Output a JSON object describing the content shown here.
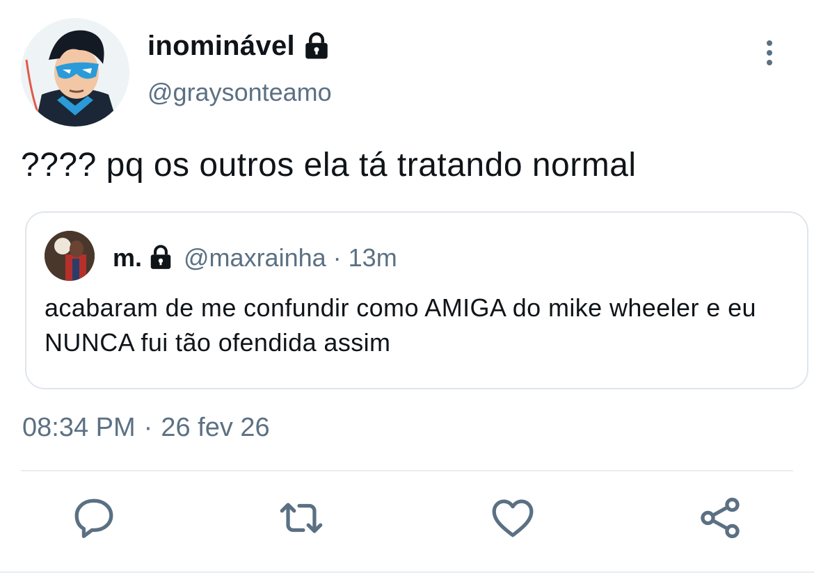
{
  "colors": {
    "text_primary": "#0f1419",
    "text_secondary": "#5b7083",
    "border": "#dfe5ea",
    "icon": "#5b7083"
  },
  "tweet": {
    "author": {
      "display_name": "inominável",
      "handle": "@graysonteamo",
      "avatar_icon": "avatar-nightwing-illustration",
      "protected_icon": "lock-icon"
    },
    "text": "???? pq os outros ela tá tratando normal",
    "menu_icon": "more-vertical-icon",
    "time": "08:34 PM",
    "separator": "·",
    "date": "26 fev 26"
  },
  "quote": {
    "author": {
      "display_name": "m.",
      "handle": "@maxrainha",
      "avatar_icon": "avatar-photo",
      "protected_icon": "lock-icon"
    },
    "separator": "·",
    "age": "13m",
    "text": "acabaram de me confundir como AMIGA do mike wheeler e eu NUNCA fui tão ofendida assim"
  },
  "actions": [
    {
      "name": "reply",
      "icon": "reply-icon"
    },
    {
      "name": "retweet",
      "icon": "retweet-icon"
    },
    {
      "name": "like",
      "icon": "heart-icon"
    },
    {
      "name": "share",
      "icon": "share-icon"
    }
  ]
}
